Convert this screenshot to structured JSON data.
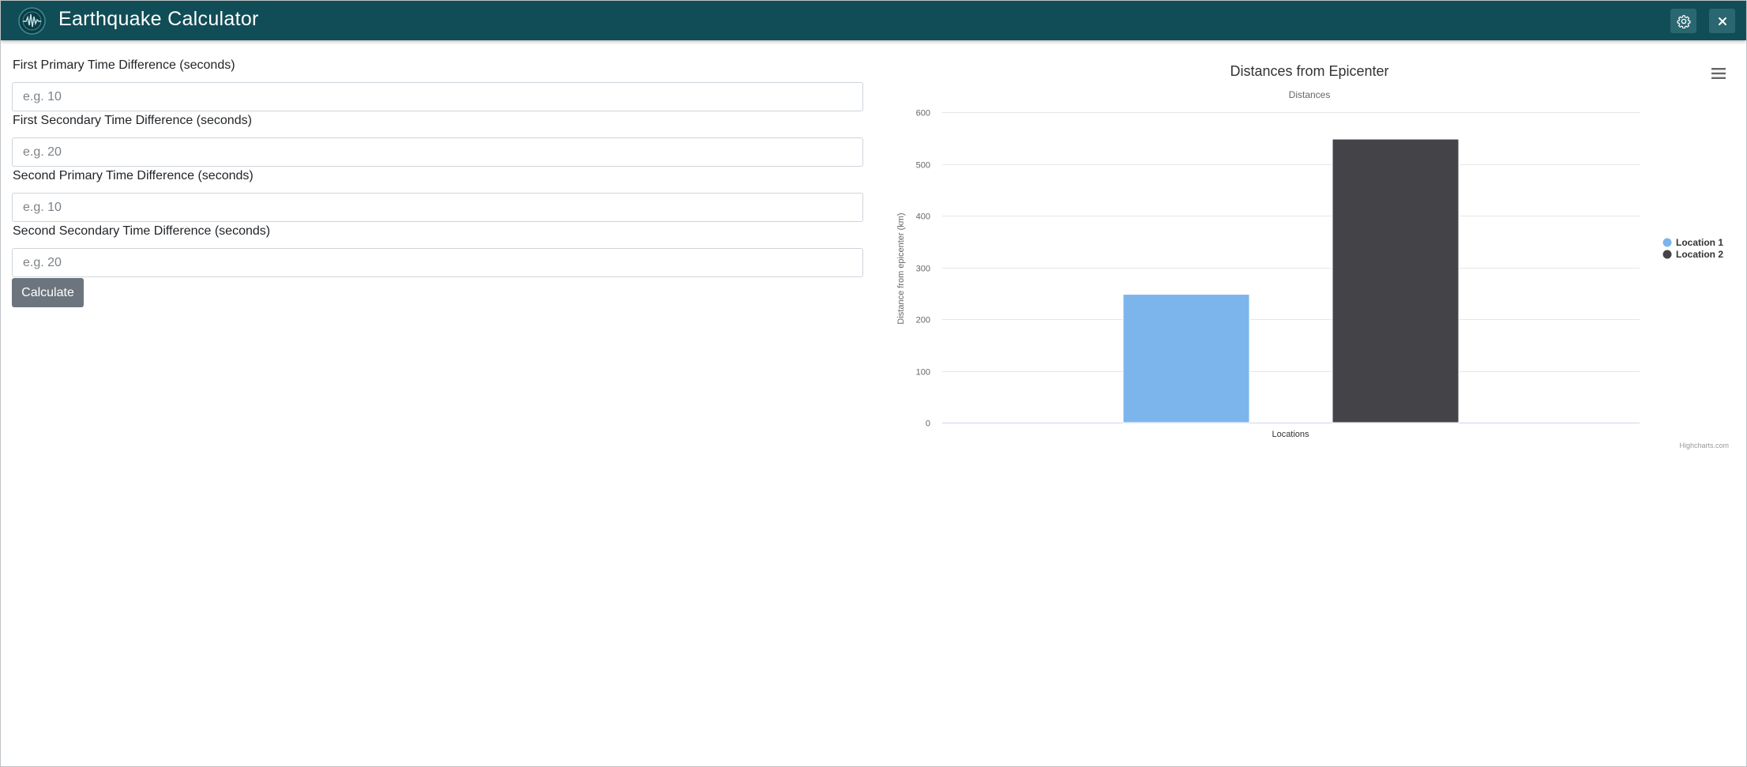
{
  "window": {
    "title": "Earthquake Calculator",
    "logo_icon": "earthquake-seismograph-logo",
    "colors": {
      "titlebar": "#114d57",
      "button": "#2b6770"
    }
  },
  "form": {
    "fields": [
      {
        "label": "First Primary Time Difference (seconds)",
        "placeholder": "e.g. 10",
        "value": ""
      },
      {
        "label": "First Secondary Time Difference (seconds)",
        "placeholder": "e.g. 20",
        "value": ""
      },
      {
        "label": "Second Primary Time Difference (seconds)",
        "placeholder": "e.g. 10",
        "value": ""
      },
      {
        "label": "Second Secondary Time Difference (seconds)",
        "placeholder": "e.g. 20",
        "value": ""
      }
    ],
    "calculate_label": "Calculate"
  },
  "chart_data": {
    "type": "bar",
    "title": "Distances from Epicenter",
    "subtitle": "Distances",
    "xlabel": "Locations",
    "ylabel": "Distance from epicenter (km)",
    "ylim": [
      0,
      600
    ],
    "yticks": [
      0,
      100,
      200,
      300,
      400,
      500,
      600
    ],
    "categories": [
      "Locations"
    ],
    "series": [
      {
        "name": "Location 1",
        "values": [
          248
        ],
        "color": "#7cb5ec"
      },
      {
        "name": "Location 2",
        "values": [
          548
        ],
        "color": "#434348"
      }
    ],
    "grid": true,
    "legend_position": "right",
    "credits": "Highcharts.com"
  }
}
